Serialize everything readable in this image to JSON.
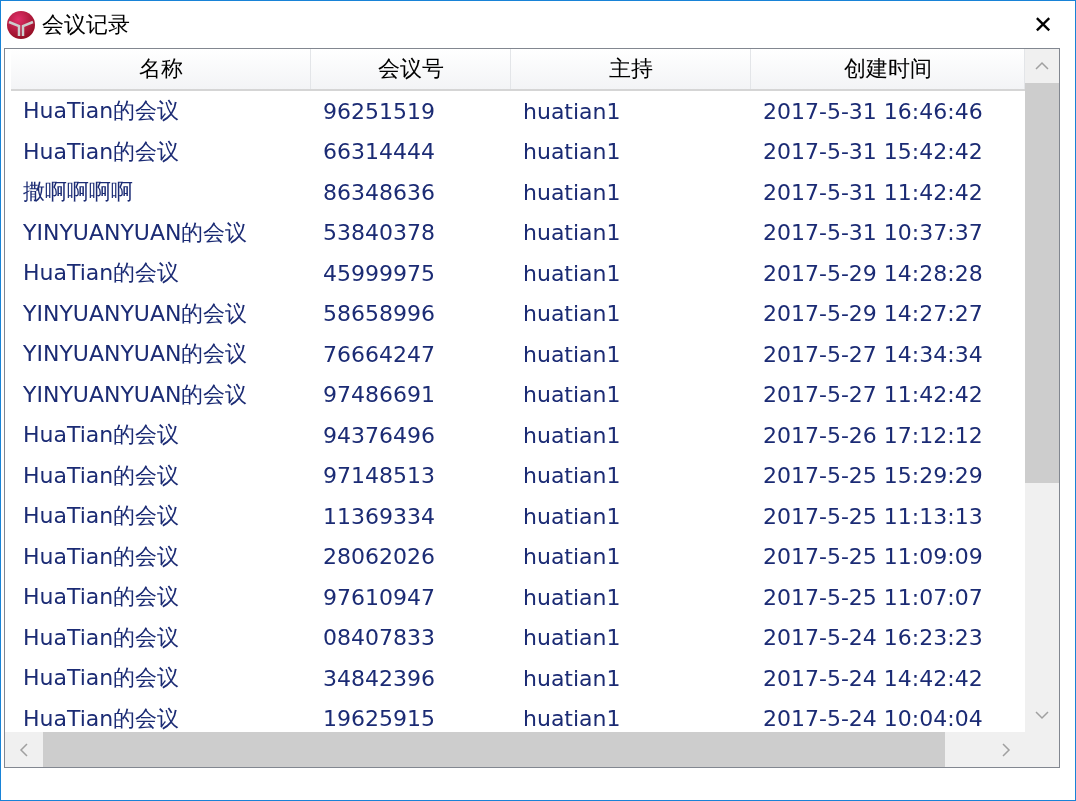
{
  "window": {
    "title": "会议记录",
    "close": "✕"
  },
  "table": {
    "columns": [
      "名称",
      "会议号",
      "主持",
      "创建时间"
    ],
    "rows": [
      [
        "HuaTian的会议",
        "96251519",
        "huatian1",
        "2017-5-31 16:46:46"
      ],
      [
        "HuaTian的会议",
        "66314444",
        "huatian1",
        "2017-5-31 15:42:42"
      ],
      [
        "撒啊啊啊啊",
        "86348636",
        "huatian1",
        "2017-5-31 11:42:42"
      ],
      [
        "YINYUANYUAN的会议",
        "53840378",
        "huatian1",
        "2017-5-31 10:37:37"
      ],
      [
        "HuaTian的会议",
        "45999975",
        "huatian1",
        "2017-5-29 14:28:28"
      ],
      [
        "YINYUANYUAN的会议",
        "58658996",
        "huatian1",
        "2017-5-29 14:27:27"
      ],
      [
        "YINYUANYUAN的会议",
        "76664247",
        "huatian1",
        "2017-5-27 14:34:34"
      ],
      [
        "YINYUANYUAN的会议",
        "97486691",
        "huatian1",
        "2017-5-27 11:42:42"
      ],
      [
        "HuaTian的会议",
        "94376496",
        "huatian1",
        "2017-5-26 17:12:12"
      ],
      [
        "HuaTian的会议",
        "97148513",
        "huatian1",
        "2017-5-25 15:29:29"
      ],
      [
        "HuaTian的会议",
        "11369334",
        "huatian1",
        "2017-5-25 11:13:13"
      ],
      [
        "HuaTian的会议",
        "28062026",
        "huatian1",
        "2017-5-25 11:09:09"
      ],
      [
        "HuaTian的会议",
        "97610947",
        "huatian1",
        "2017-5-25 11:07:07"
      ],
      [
        "HuaTian的会议",
        "08407833",
        "huatian1",
        "2017-5-24 16:23:23"
      ],
      [
        "HuaTian的会议",
        "34842396",
        "huatian1",
        "2017-5-24 14:42:42"
      ],
      [
        "HuaTian的会议",
        "19625915",
        "huatian1",
        "2017-5-24 10:04:04"
      ]
    ]
  }
}
